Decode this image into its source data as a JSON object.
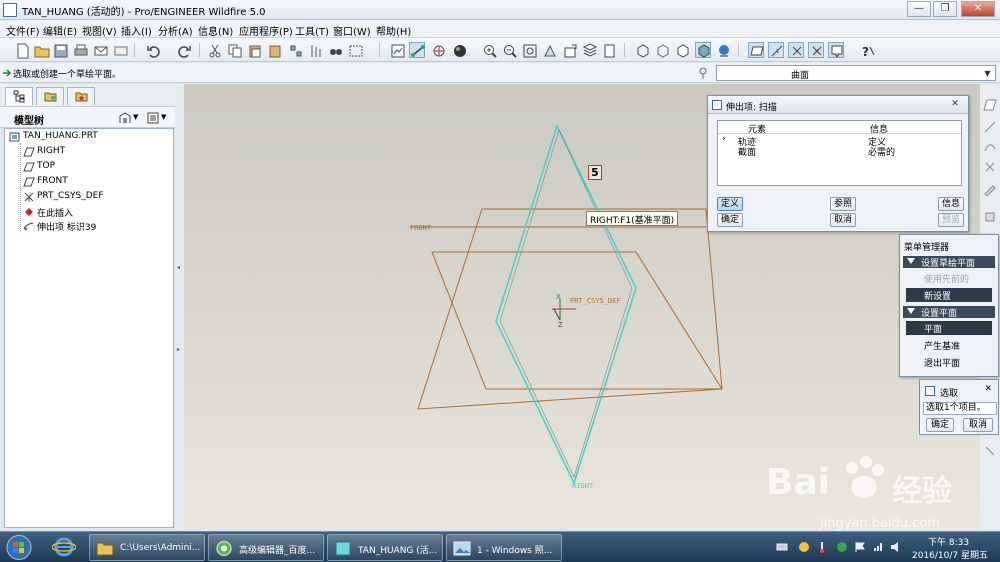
{
  "window": {
    "title": "TAN_HUANG (活动的) - Pro/ENGINEER Wildfire 5.0"
  },
  "menu": [
    "文件(F)",
    "编辑(E)",
    "视图(V)",
    "插入(I)",
    "分析(A)",
    "信息(N)",
    "应用程序(P)",
    "工具(T)",
    "窗口(W)",
    "帮助(H)"
  ],
  "message": {
    "text": "选取或创建一个草绘平面。"
  },
  "filter": {
    "value": "曲面"
  },
  "model_tree": {
    "header": "模型树",
    "items": [
      {
        "label": "TAN_HUANG.PRT",
        "icon": "part-icon"
      },
      {
        "label": "RIGHT",
        "icon": "datum-plane-icon"
      },
      {
        "label": "TOP",
        "icon": "datum-plane-icon"
      },
      {
        "label": "FRONT",
        "icon": "datum-plane-icon"
      },
      {
        "label": "PRT_CSYS_DEF",
        "icon": "csys-icon"
      },
      {
        "label": "在此插入",
        "icon": "insert-here-icon"
      },
      {
        "label": "伸出项 标识39",
        "icon": "protrusion-icon"
      }
    ]
  },
  "graphics": {
    "plane_labels": {
      "front": "FRONT",
      "right": "RIGHT",
      "csys": "PRT_CSYS_DEF",
      "csys_x": "X",
      "csys_z": "Z"
    },
    "tooltip": "RIGHT:F1(基准平面)",
    "badge": "5"
  },
  "sweep_dialog": {
    "title": "伸出项: 扫描",
    "columns": [
      "元素",
      "信息"
    ],
    "rows": [
      {
        "element": "轨迹",
        "info": "定义"
      },
      {
        "element": "截面",
        "info": "必需的"
      }
    ],
    "buttons": {
      "define": "定义",
      "refs": "参照",
      "info": "信息",
      "ok": "确定",
      "cancel": "取消",
      "preview": "预览"
    }
  },
  "menu_manager": {
    "title": "菜单管理器",
    "section1": "设置草绘平面",
    "use_previous": "使用先前的",
    "new_setup": "新设置",
    "section2": "设置平面",
    "plane": "平面",
    "make_datum": "产生基准",
    "quit_plane": "退出平面"
  },
  "select_dialog": {
    "title": "选取",
    "text": "选取1个项目。",
    "ok": "确定",
    "cancel": "取消"
  },
  "taskbar": {
    "items": [
      "C:\\Users\\Admini...",
      "高级编辑器_百度...",
      "TAN_HUANG (活...",
      "1 - Windows 照..."
    ],
    "time": "下午 8:33",
    "date": "2016/10/7 星期五"
  },
  "watermark": {
    "brand": "Bai",
    "brand2": "经验",
    "url": "jingyan.baidu.com"
  },
  "colors": {
    "datum_plane": "#b56a2c",
    "highlight": "#3bd2c8",
    "csys": "#d12a2a"
  }
}
